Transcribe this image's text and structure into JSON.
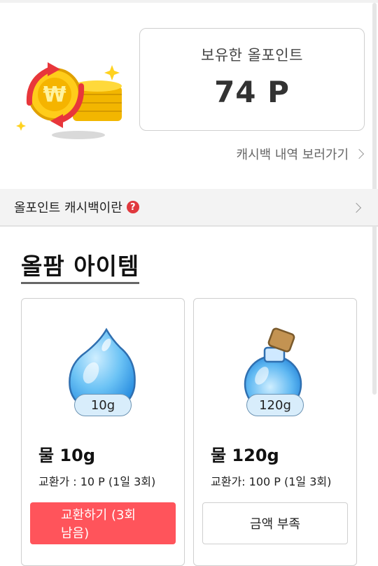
{
  "points": {
    "title": "보유한 올포인트",
    "value": "74 P"
  },
  "history_link": {
    "label": "캐시백 내역 보러가기"
  },
  "info_bar": {
    "label": "올포인트 캐시백이란",
    "help_icon": "?"
  },
  "section": {
    "title": "올팜 아이템"
  },
  "items": [
    {
      "icon": "water-drop-icon",
      "amount": "10g",
      "name": "물 10g",
      "price": "교환가 : 10 P (1일 3회)",
      "button": "교환하기 (3회 남음)",
      "button_state": "active"
    },
    {
      "icon": "water-bottle-icon",
      "amount": "120g",
      "name": "물 120g",
      "price": "교환가: 100 P (1일 3회)",
      "button": "금액 부족",
      "button_state": "disabled"
    }
  ],
  "colors": {
    "accent_red": "#ff545b",
    "help_red": "#e0393e",
    "coin_gold": "#f5c400",
    "pill_blue": "#d8edfb"
  }
}
